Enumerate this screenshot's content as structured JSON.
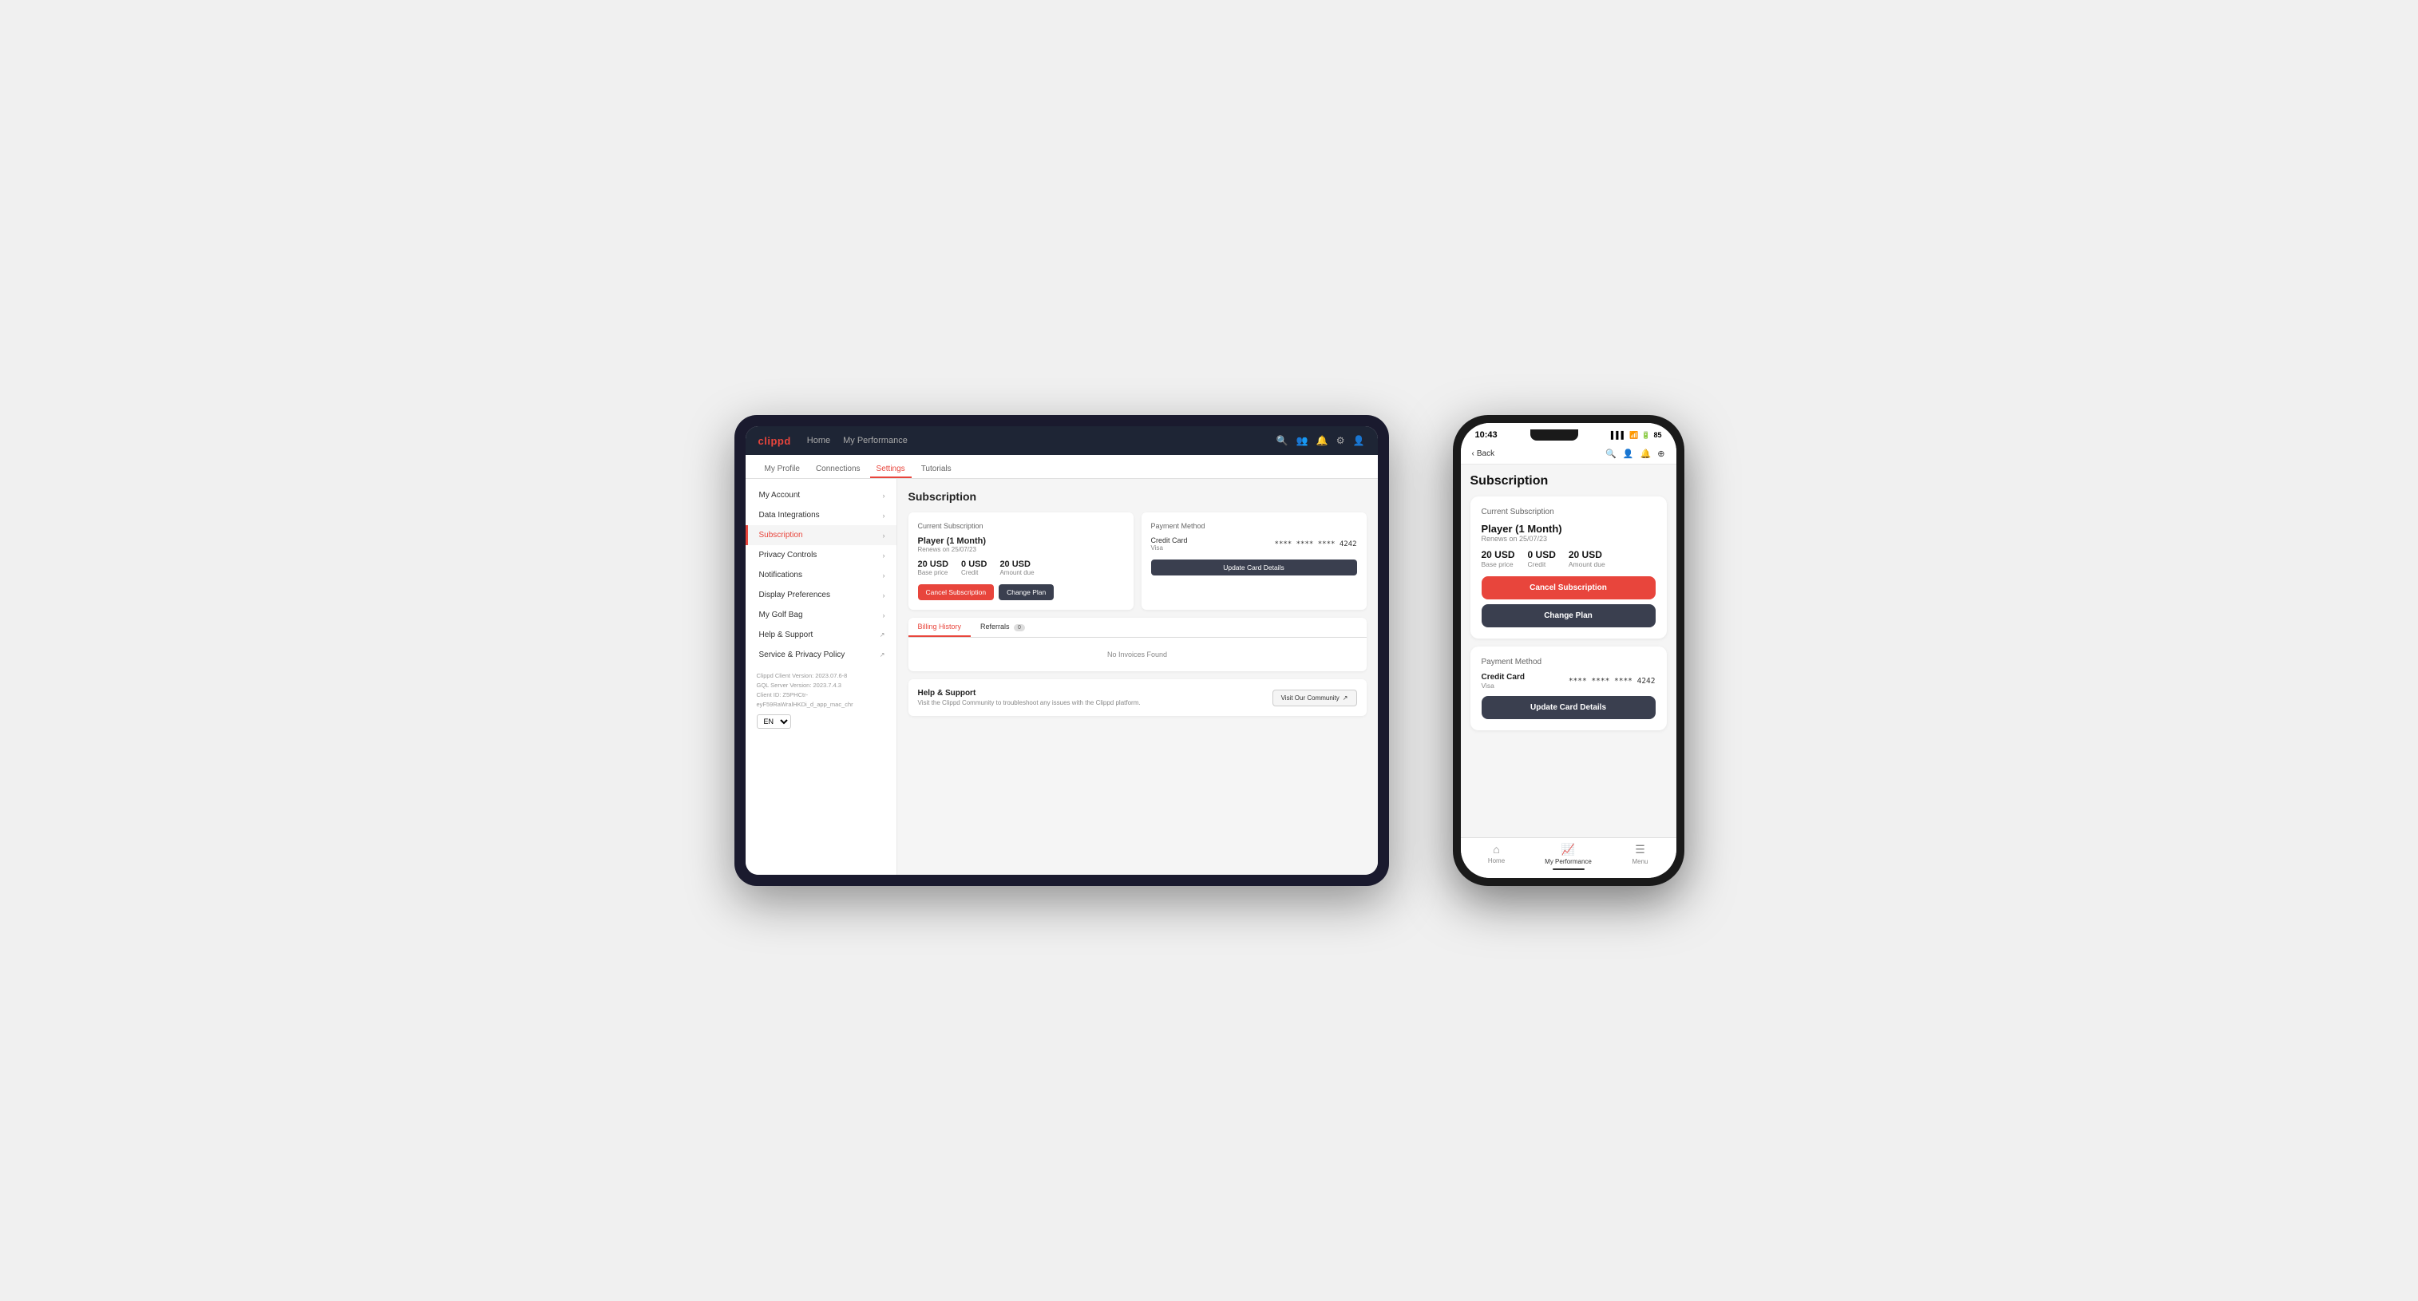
{
  "app": {
    "logo": "clippd",
    "nav_links": [
      "Home",
      "My Performance"
    ],
    "subnav": [
      "My Profile",
      "Connections",
      "Settings",
      "Tutorials"
    ],
    "active_subnav": "Settings"
  },
  "sidebar": {
    "items": [
      {
        "label": "My Account",
        "active": false
      },
      {
        "label": "Data Integrations",
        "active": false
      },
      {
        "label": "Subscription",
        "active": true
      },
      {
        "label": "Privacy Controls",
        "active": false
      },
      {
        "label": "Notifications",
        "active": false
      },
      {
        "label": "Display Preferences",
        "active": false
      },
      {
        "label": "My Golf Bag",
        "active": false
      },
      {
        "label": "Help & Support",
        "active": false,
        "external": true
      },
      {
        "label": "Service & Privacy Policy",
        "active": false,
        "external": true
      }
    ],
    "footer": {
      "client_version": "Clippd Client Version: 2023.07.6-8",
      "gql_version": "GQL Server Version: 2023.7.4.3",
      "client_id": "Client ID: Z5PHCtr-eyF59RaWralHKDi_d_app_mac_chr"
    },
    "language": "EN"
  },
  "tablet": {
    "page_title": "Subscription",
    "current_subscription": {
      "section_title": "Current Subscription",
      "plan_name": "Player (1 Month)",
      "renew_text": "Renews on 25/07/23",
      "base_price_value": "20 USD",
      "base_price_label": "Base price",
      "credit_value": "0 USD",
      "credit_label": "Credit",
      "amount_due_value": "20 USD",
      "amount_due_label": "Amount due",
      "cancel_btn": "Cancel Subscription",
      "change_btn": "Change Plan"
    },
    "payment_method": {
      "section_title": "Payment Method",
      "card_type": "Credit Card",
      "card_brand": "Visa",
      "card_number": "**** **** **** 4242",
      "update_btn": "Update Card Details"
    },
    "billing_tabs": [
      {
        "label": "Billing History",
        "active": true
      },
      {
        "label": "Referrals",
        "active": false,
        "badge": "0"
      }
    ],
    "no_invoices": "No Invoices Found",
    "help": {
      "title": "Help & Support",
      "description": "Visit the Clippd Community to troubleshoot any issues with the Clippd platform.",
      "btn_label": "Visit Our Community"
    }
  },
  "phone": {
    "status_bar": {
      "time": "10:43",
      "battery": "85",
      "signal": "●●●"
    },
    "back_label": "Back",
    "nav_icons": [
      "search",
      "person",
      "bell",
      "add"
    ],
    "page_title": "Subscription",
    "current_subscription": {
      "section_title": "Current Subscription",
      "plan_name": "Player (1 Month)",
      "renew_text": "Renews on 25/07/23",
      "base_price_value": "20 USD",
      "base_price_label": "Base price",
      "credit_value": "0 USD",
      "credit_label": "Credit",
      "amount_due_value": "20 USD",
      "amount_due_label": "Amount due",
      "cancel_btn": "Cancel Subscription",
      "change_btn": "Change Plan"
    },
    "payment_method": {
      "section_title": "Payment Method",
      "card_type": "Credit Card",
      "card_brand": "Visa",
      "card_number": "**** **** **** 4242",
      "update_btn": "Update Card Details"
    },
    "bottom_nav": [
      {
        "label": "Home",
        "icon": "⌂",
        "active": false
      },
      {
        "label": "My Performance",
        "icon": "📈",
        "active": true
      },
      {
        "label": "Menu",
        "icon": "☰",
        "active": false
      }
    ]
  }
}
